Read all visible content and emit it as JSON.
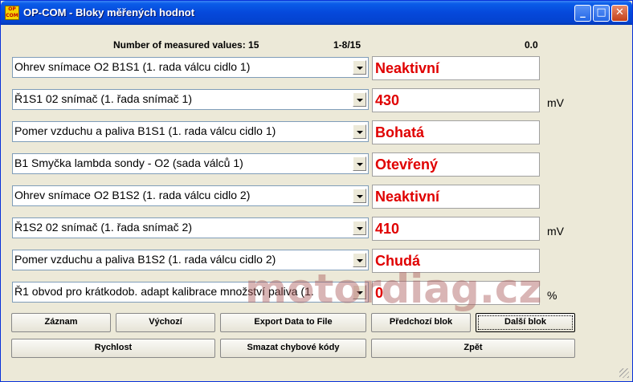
{
  "window": {
    "title": "OP-COM - Bloky měřených hodnot",
    "icon_text": "OP COM",
    "controls": {
      "minimize": "_",
      "maximize": "□",
      "close": "✕"
    }
  },
  "header": {
    "count_label": "Number of measured values: 15",
    "range_label": "1-8/15",
    "time_value": "0.0"
  },
  "rows": [
    {
      "label": "Ohrev snímace O2 B1S1 (1. rada válcu cidlo 1)",
      "value": "Neaktivní",
      "unit": ""
    },
    {
      "label": "Ř1S1 02 snímač (1. řada snímač 1)",
      "value": "430",
      "unit": "mV"
    },
    {
      "label": "Pomer vzduchu a paliva B1S1 (1. rada válcu cidlo 1)",
      "value": "Bohatá",
      "unit": ""
    },
    {
      "label": "B1 Smyčka lambda sondy - O2 (sada válců 1)",
      "value": "Otevřený",
      "unit": ""
    },
    {
      "label": "Ohrev snímace O2 B1S2 (1. rada válcu cidlo 2)",
      "value": "Neaktivní",
      "unit": ""
    },
    {
      "label": "Ř1S2 02 snímač (1. řada snímač 2)",
      "value": "410",
      "unit": "mV"
    },
    {
      "label": "Pomer vzduchu a paliva B1S2 (1. rada válcu cidlo 2)",
      "value": "Chudá",
      "unit": ""
    },
    {
      "label": "Ř1 obvod pro krátkodob. adapt kalibrace množství paliva (1.",
      "value": "0",
      "unit": "%"
    }
  ],
  "watermark": "motordiag.cz",
  "buttons": {
    "record": "Záznam",
    "default": "Výchozí",
    "export": "Export Data to File",
    "prev_block": "Předchozí blok",
    "next_block": "Další blok",
    "speed": "Rychlost",
    "clear_dtc": "Smazat chybové kódy",
    "back": "Zpět"
  },
  "colors": {
    "value_text": "#e00000",
    "title_bar": "#0548db",
    "window_bg": "#ece9d8"
  }
}
